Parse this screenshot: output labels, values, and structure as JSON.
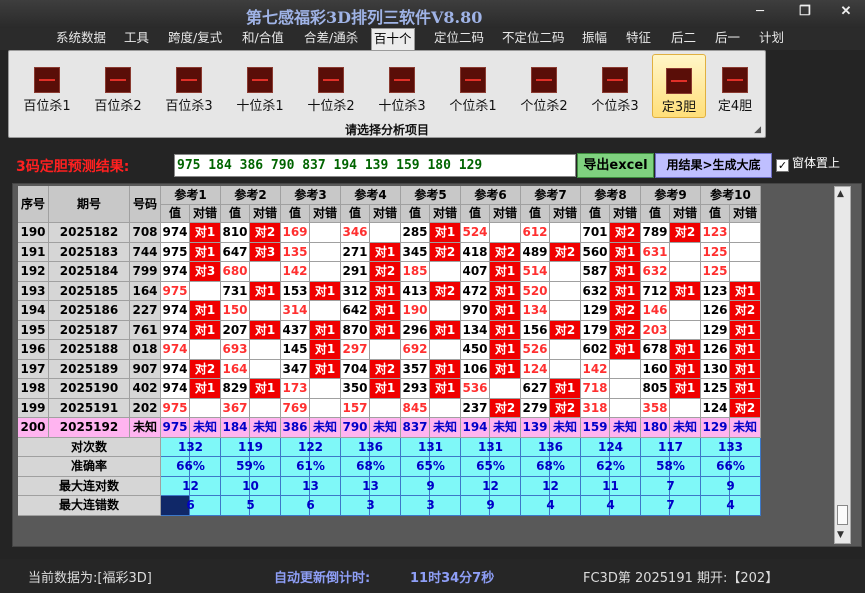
{
  "window": {
    "title": "第七感福彩3D排列三软件V8.80",
    "controls": [
      "─",
      "❐",
      "✕"
    ]
  },
  "menu": {
    "items": [
      "系统数据",
      "工具",
      "跨度/复式",
      "和/合值",
      "合差/通杀",
      "百十个",
      "定位二码",
      "不定位二码",
      "振幅",
      "特征",
      "后二",
      "后一",
      "计划"
    ],
    "active": "百十个"
  },
  "ribbon": {
    "buttons": [
      "百位杀1",
      "百位杀2",
      "百位杀3",
      "十位杀1",
      "十位杀2",
      "十位杀3",
      "个位杀1",
      "个位杀2",
      "个位杀3",
      "定3胆",
      "定4胆"
    ],
    "selected": "定3胆",
    "caption": "请选择分析项目",
    "launcher_icon": "dialog-launcher-icon"
  },
  "prediction": {
    "label": "3码定胆预测结果:",
    "value": "975 184 386 790 837 194 139 159 180 129"
  },
  "actions": {
    "export_label": "导出excel",
    "generate_label": "用结果>生成大底"
  },
  "option": {
    "label": "窗体置上",
    "checked": true,
    "mark": "✓"
  },
  "table": {
    "headers": {
      "index": "序号",
      "period": "期号",
      "code": "号码",
      "value": "值",
      "hit": "对错",
      "refs": [
        "参考1",
        "参考2",
        "参考3",
        "参考4",
        "参考5",
        "参考6",
        "参考7",
        "参考8",
        "参考9",
        "参考10"
      ]
    },
    "rows": [
      {
        "idx": "190",
        "period": "2025182",
        "code": "708",
        "cells": [
          [
            "974",
            "对1",
            0
          ],
          [
            "810",
            "对2",
            0
          ],
          [
            "169",
            "",
            1
          ],
          [
            "346",
            "",
            1
          ],
          [
            "285",
            "对1",
            0
          ],
          [
            "524",
            "",
            1
          ],
          [
            "612",
            "",
            1
          ],
          [
            "701",
            "对2",
            0
          ],
          [
            "789",
            "对2",
            0
          ],
          [
            "123",
            "",
            1
          ]
        ]
      },
      {
        "idx": "191",
        "period": "2025183",
        "code": "744",
        "cells": [
          [
            "975",
            "对1",
            0
          ],
          [
            "647",
            "对3",
            0
          ],
          [
            "135",
            "",
            1
          ],
          [
            "271",
            "对1",
            0
          ],
          [
            "345",
            "对2",
            0
          ],
          [
            "418",
            "对2",
            0
          ],
          [
            "489",
            "对2",
            0
          ],
          [
            "560",
            "对1",
            0
          ],
          [
            "631",
            "",
            1
          ],
          [
            "125",
            "",
            1
          ]
        ]
      },
      {
        "idx": "192",
        "period": "2025184",
        "code": "799",
        "cells": [
          [
            "974",
            "对3",
            0
          ],
          [
            "680",
            "",
            1
          ],
          [
            "142",
            "",
            1
          ],
          [
            "291",
            "对2",
            0
          ],
          [
            "185",
            "",
            1
          ],
          [
            "407",
            "对1",
            0
          ],
          [
            "514",
            "",
            1
          ],
          [
            "587",
            "对1",
            0
          ],
          [
            "632",
            "",
            1
          ],
          [
            "125",
            "",
            1
          ]
        ]
      },
      {
        "idx": "193",
        "period": "2025185",
        "code": "164",
        "cells": [
          [
            "975",
            "",
            1
          ],
          [
            "731",
            "对1",
            0
          ],
          [
            "153",
            "对1",
            0
          ],
          [
            "312",
            "对1",
            0
          ],
          [
            "413",
            "对2",
            0
          ],
          [
            "472",
            "对1",
            0
          ],
          [
            "520",
            "",
            1
          ],
          [
            "632",
            "对1",
            0
          ],
          [
            "712",
            "对1",
            0
          ],
          [
            "123",
            "对1",
            0
          ]
        ]
      },
      {
        "idx": "194",
        "period": "2025186",
        "code": "227",
        "cells": [
          [
            "974",
            "对1",
            0
          ],
          [
            "150",
            "",
            1
          ],
          [
            "314",
            "",
            1
          ],
          [
            "642",
            "对1",
            0
          ],
          [
            "190",
            "",
            1
          ],
          [
            "970",
            "对1",
            0
          ],
          [
            "134",
            "",
            1
          ],
          [
            "129",
            "对2",
            0
          ],
          [
            "146",
            "",
            1
          ],
          [
            "126",
            "对2",
            0
          ]
        ]
      },
      {
        "idx": "195",
        "period": "2025187",
        "code": "761",
        "cells": [
          [
            "974",
            "对1",
            0
          ],
          [
            "207",
            "对1",
            0
          ],
          [
            "437",
            "对1",
            0
          ],
          [
            "870",
            "对1",
            0
          ],
          [
            "296",
            "对1",
            0
          ],
          [
            "134",
            "对1",
            0
          ],
          [
            "156",
            "对2",
            0
          ],
          [
            "179",
            "对2",
            0
          ],
          [
            "203",
            "",
            1
          ],
          [
            "129",
            "对1",
            0
          ]
        ]
      },
      {
        "idx": "196",
        "period": "2025188",
        "code": "018",
        "cells": [
          [
            "974",
            "",
            1
          ],
          [
            "693",
            "",
            1
          ],
          [
            "145",
            "对1",
            0
          ],
          [
            "297",
            "",
            1
          ],
          [
            "692",
            "",
            1
          ],
          [
            "450",
            "对1",
            0
          ],
          [
            "526",
            "",
            1
          ],
          [
            "602",
            "对1",
            0
          ],
          [
            "678",
            "对1",
            0
          ],
          [
            "126",
            "对1",
            0
          ]
        ]
      },
      {
        "idx": "197",
        "period": "2025189",
        "code": "907",
        "cells": [
          [
            "974",
            "对2",
            0
          ],
          [
            "164",
            "",
            1
          ],
          [
            "347",
            "对1",
            0
          ],
          [
            "704",
            "对2",
            0
          ],
          [
            "357",
            "对1",
            0
          ],
          [
            "106",
            "对1",
            0
          ],
          [
            "124",
            "",
            1
          ],
          [
            "142",
            "",
            1
          ],
          [
            "160",
            "对1",
            0
          ],
          [
            "130",
            "对1",
            0
          ]
        ]
      },
      {
        "idx": "198",
        "period": "2025190",
        "code": "402",
        "cells": [
          [
            "974",
            "对1",
            0
          ],
          [
            "829",
            "对1",
            0
          ],
          [
            "173",
            "",
            1
          ],
          [
            "350",
            "对1",
            0
          ],
          [
            "293",
            "对1",
            0
          ],
          [
            "536",
            "",
            1
          ],
          [
            "627",
            "对1",
            0
          ],
          [
            "718",
            "",
            1
          ],
          [
            "805",
            "对1",
            0
          ],
          [
            "125",
            "对1",
            0
          ]
        ]
      },
      {
        "idx": "199",
        "period": "2025191",
        "code": "202",
        "cells": [
          [
            "975",
            "",
            1
          ],
          [
            "367",
            "",
            1
          ],
          [
            "769",
            "",
            1
          ],
          [
            "157",
            "",
            1
          ],
          [
            "845",
            "",
            1
          ],
          [
            "237",
            "对2",
            0
          ],
          [
            "279",
            "对2",
            0
          ],
          [
            "318",
            "",
            1
          ],
          [
            "358",
            "",
            1
          ],
          [
            "124",
            "对2",
            0
          ]
        ]
      },
      {
        "idx": "200",
        "period": "2025192",
        "code": "未知",
        "cells": [
          [
            "975",
            "未知",
            2
          ],
          [
            "184",
            "未知",
            2
          ],
          [
            "386",
            "未知",
            2
          ],
          [
            "790",
            "未知",
            2
          ],
          [
            "837",
            "未知",
            2
          ],
          [
            "194",
            "未知",
            2
          ],
          [
            "139",
            "未知",
            2
          ],
          [
            "159",
            "未知",
            2
          ],
          [
            "180",
            "未知",
            2
          ],
          [
            "129",
            "未知",
            2
          ]
        ]
      }
    ],
    "stats": [
      {
        "label": "对次数",
        "values": [
          "132",
          "119",
          "122",
          "136",
          "131",
          "131",
          "136",
          "124",
          "117",
          "133"
        ]
      },
      {
        "label": "准确率",
        "values": [
          "66%",
          "59%",
          "61%",
          "68%",
          "65%",
          "65%",
          "68%",
          "62%",
          "58%",
          "66%"
        ]
      },
      {
        "label": "最大连对数",
        "values": [
          "12",
          "10",
          "13",
          "13",
          "9",
          "12",
          "12",
          "11",
          "7",
          "9"
        ]
      },
      {
        "label": "最大连错数",
        "values": [
          "6",
          "5",
          "6",
          "3",
          "3",
          "9",
          "4",
          "4",
          "7",
          "4"
        ]
      }
    ]
  },
  "scrollbar": {
    "up": "▲",
    "down": "▼"
  },
  "status": {
    "current_label": "当前数据为:[福彩3D]",
    "countdown_label": "自动更新倒计时:",
    "countdown_value": "11时34分7秒",
    "period_info": "FC3D第 2025191 期开:【202】"
  },
  "colors": {
    "red": "#f00000",
    "cyan": "#7ff8f8",
    "pink": "#ffb4f0",
    "miss": "#ff3030",
    "hit_text": "#ffffff",
    "value_text": "#000000",
    "stat_text": "#0000c8",
    "header_bg": "#c8c8c8",
    "left_bg": "#d6d6d6",
    "dark_cell": "#102868"
  }
}
